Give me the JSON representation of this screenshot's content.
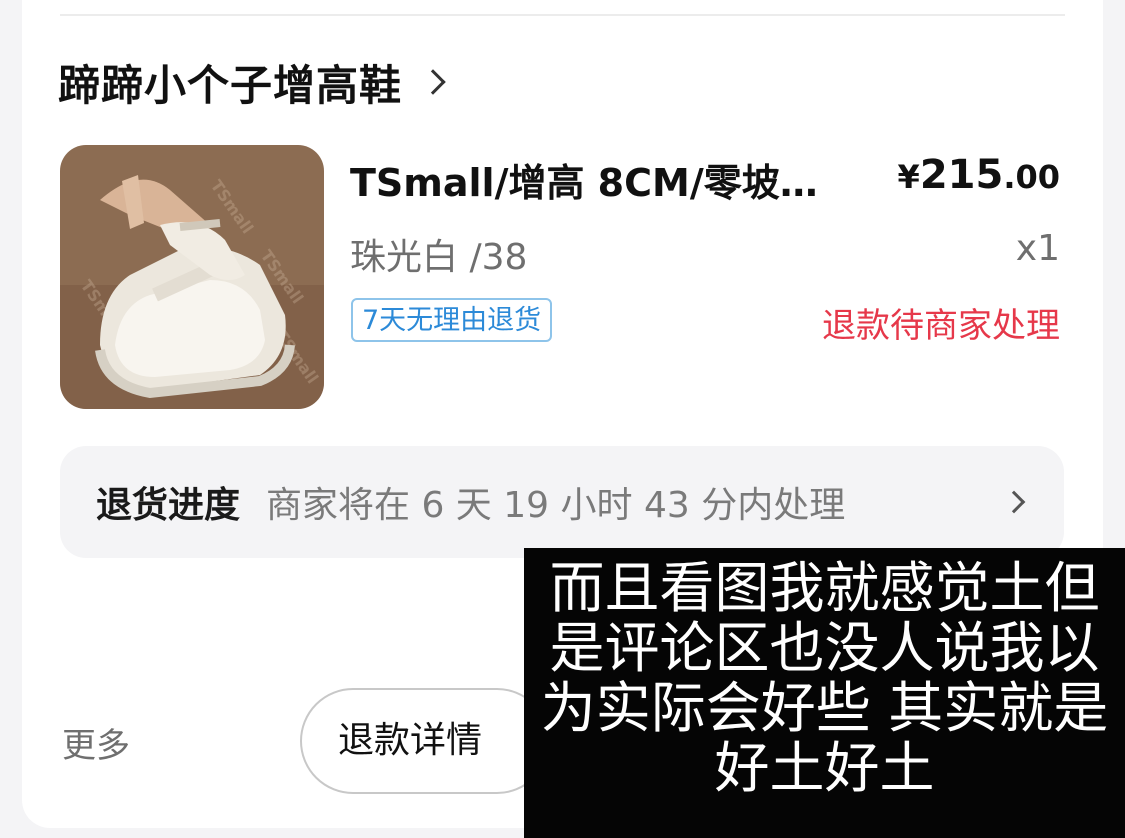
{
  "shop": {
    "name": "蹄蹄小个子增高鞋"
  },
  "product": {
    "title": "TSmall/增高 8CM/零坡…",
    "price_symbol": "¥",
    "price_integer": "215",
    "price_decimal": ".00",
    "sku": "珠光白 /38",
    "quantity": "x1",
    "return_badge": "7天无理由退货",
    "refund_status": "退款待商家处理",
    "image_watermark": "TSmall"
  },
  "return_progress": {
    "label": "退货进度",
    "text": "商家将在 6 天 19 小时 43 分内处理"
  },
  "actions": {
    "more": "更多",
    "refund_details": "退款详情"
  },
  "caption": {
    "lines": [
      "而且看图我就感觉土但",
      "是评论区也没人说我以",
      "为实际会好些 其实就是",
      "好土好土"
    ]
  },
  "colors": {
    "refund_status": "#e6384a",
    "badge_text": "#2c8ad8",
    "badge_border": "#8ec4ea"
  }
}
